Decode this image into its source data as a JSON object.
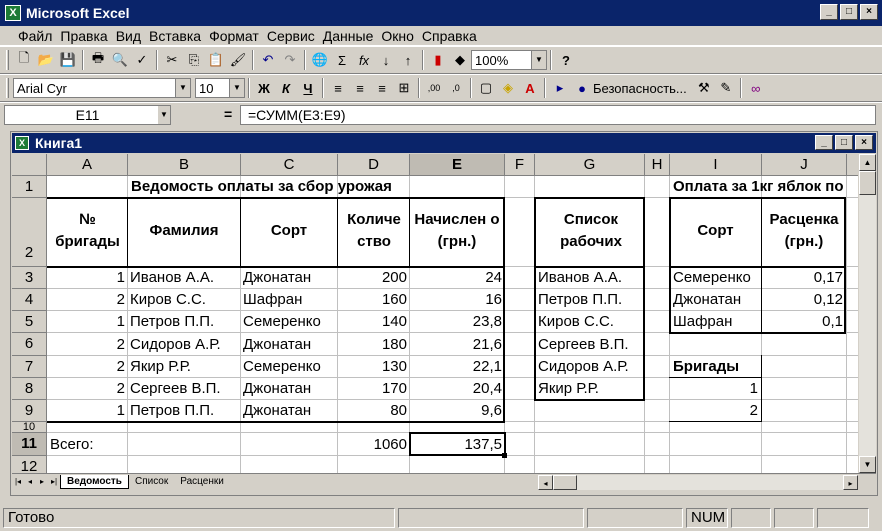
{
  "app": {
    "title": "Microsoft Excel",
    "win_min": "_",
    "win_max": "□",
    "win_close": "×"
  },
  "menu": [
    "Файл",
    "Правка",
    "Вид",
    "Вставка",
    "Формат",
    "Сервис",
    "Данные",
    "Окно",
    "Справка"
  ],
  "toolbar1": {
    "zoom": "100%",
    "help": "?"
  },
  "toolbar2": {
    "font": "Arial Cyr",
    "size": "10",
    "bold": "Ж",
    "italic": "К",
    "underline": "Ч",
    "security": "Безопасность..."
  },
  "formula_bar": {
    "name_box": "E11",
    "equals": "=",
    "formula": "=СУММ(E3:E9)"
  },
  "workbook": {
    "title": "Книга1"
  },
  "columns": [
    "A",
    "B",
    "C",
    "D",
    "E",
    "F",
    "G",
    "H",
    "I",
    "J"
  ],
  "rows": [
    "1",
    "2",
    "3",
    "4",
    "5",
    "6",
    "7",
    "8",
    "9",
    "10",
    "11",
    "12"
  ],
  "sheet": {
    "title": "Ведомость оплаты за сбор урожая",
    "headers": {
      "brigade": "№ бригады",
      "surname": "Фамилия",
      "variety": "Сорт",
      "qty": "Количе ство",
      "accrued": "Начислен о (грн.)"
    },
    "table": [
      {
        "brigade": "1",
        "name": "Иванов А.А.",
        "variety": "Джонатан",
        "qty": "200",
        "accrued": "24"
      },
      {
        "brigade": "2",
        "name": "Киров С.С.",
        "variety": "Шафран",
        "qty": "160",
        "accrued": "16"
      },
      {
        "brigade": "1",
        "name": "Петров П.П.",
        "variety": "Семеренко",
        "qty": "140",
        "accrued": "23,8"
      },
      {
        "brigade": "2",
        "name": "Сидоров А.Р.",
        "variety": "Джонатан",
        "qty": "180",
        "accrued": "21,6"
      },
      {
        "brigade": "2",
        "name": "Якир Р.Р.",
        "variety": "Семеренко",
        "qty": "130",
        "accrued": "22,1"
      },
      {
        "brigade": "2",
        "name": "Сергеев В.П.",
        "variety": "Джонатан",
        "qty": "170",
        "accrued": "20,4"
      },
      {
        "brigade": "1",
        "name": "Петров П.П.",
        "variety": "Джонатан",
        "qty": "80",
        "accrued": "9,6"
      }
    ],
    "total_label": "Всего:",
    "total_qty": "1060",
    "total_accrued": "137,5",
    "workers_header": "Список рабочих",
    "workers": [
      "Иванов А.А.",
      "Петров П.П.",
      "Киров С.С.",
      "Сергеев В.П.",
      "Сидоров А.Р.",
      "Якир Р.Р."
    ],
    "price_title": "Оплата за 1кг яблок по",
    "price_headers": {
      "variety": "Сорт",
      "price": "Расценка (грн.)"
    },
    "prices": [
      {
        "variety": "Семеренко",
        "price": "0,17"
      },
      {
        "variety": "Джонатан",
        "price": "0,12"
      },
      {
        "variety": "Шафран",
        "price": "0,1"
      }
    ],
    "brigades_label": "Бригады",
    "brigades": [
      "1",
      "2"
    ]
  },
  "tabs": [
    "Ведомость",
    "Список",
    "Расценки"
  ],
  "status": {
    "ready": "Готово",
    "num": "NUM"
  }
}
